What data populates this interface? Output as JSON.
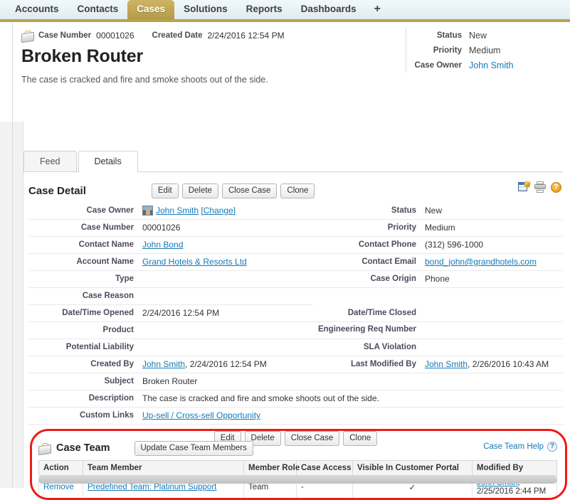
{
  "nav": {
    "tabs": [
      {
        "label": "Accounts",
        "active": false
      },
      {
        "label": "Contacts",
        "active": false
      },
      {
        "label": "Cases",
        "active": true
      },
      {
        "label": "Solutions",
        "active": false
      },
      {
        "label": "Reports",
        "active": false
      },
      {
        "label": "Dashboards",
        "active": false
      }
    ],
    "add_tab_label": "+"
  },
  "record_header": {
    "case_number_label": "Case Number",
    "case_number_value": "00001026",
    "created_date_label": "Created Date",
    "created_date_value": "2/24/2016 12:54 PM",
    "title": "Broken Router",
    "description": "The case is cracked and fire and smoke shoots out of the side.",
    "highlights": [
      {
        "label": "Status",
        "value": "New",
        "link": false
      },
      {
        "label": "Priority",
        "value": "Medium",
        "link": false
      },
      {
        "label": "Case Owner",
        "value": "John Smith",
        "link": true
      }
    ]
  },
  "subtabs": [
    {
      "label": "Feed",
      "active": false
    },
    {
      "label": "Details",
      "active": true
    }
  ],
  "case_detail": {
    "title": "Case Detail",
    "buttons": [
      "Edit",
      "Delete",
      "Close Case",
      "Clone"
    ],
    "buttons_bottom": [
      "Edit",
      "Delete",
      "Close Case",
      "Clone"
    ],
    "icons": [
      "edit-layout-icon",
      "printer-icon",
      "help-icon"
    ],
    "rows": [
      {
        "label": "Case Owner",
        "value": "John Smith",
        "link": true,
        "avatar": true,
        "change": "[Change]",
        "label2": "Status",
        "value2": "New",
        "link2": false
      },
      {
        "label": "Case Number",
        "value": "00001026",
        "link": false,
        "label2": "Priority",
        "value2": "Medium",
        "link2": false
      },
      {
        "label": "Contact Name",
        "value": "John Bond",
        "link": true,
        "label2": "Contact Phone",
        "value2": "(312) 596-1000",
        "link2": false
      },
      {
        "label": "Account Name",
        "value": "Grand Hotels & Resorts Ltd",
        "link": true,
        "label2": "Contact Email",
        "value2": "bond_john@grandhotels.com",
        "link2": true
      },
      {
        "label": "Type",
        "value": "",
        "link": false,
        "label2": "Case Origin",
        "value2": "Phone",
        "link2": false
      },
      {
        "label": "Case Reason",
        "value": "",
        "link": false,
        "label2": "",
        "value2": "",
        "link2": false
      },
      {
        "label": "Date/Time Opened",
        "value": "2/24/2016 12:54 PM",
        "link": false,
        "label2": "Date/Time Closed",
        "value2": "",
        "link2": false
      },
      {
        "label": "Product",
        "value": "",
        "link": false,
        "label2": "Engineering Req Number",
        "value2": "",
        "link2": false
      },
      {
        "label": "Potential Liability",
        "value": "",
        "link": false,
        "label2": "SLA Violation",
        "value2": "",
        "link2": false
      },
      {
        "label": "Created By",
        "value": "John Smith",
        "link": true,
        "suffix": ", 2/24/2016 12:54 PM",
        "label2": "Last Modified By",
        "value2": "John Smith",
        "link2": true,
        "suffix2": ", 2/26/2016 10:43 AM"
      }
    ],
    "wide_rows": [
      {
        "label": "Subject",
        "value": "Broken Router",
        "link": false
      },
      {
        "label": "Description",
        "value": "The case is cracked and fire and smoke shoots out of the side.",
        "link": false
      },
      {
        "label": "Custom Links",
        "value": "Up-sell / Cross-sell Opportunity",
        "link": true
      }
    ]
  },
  "case_team": {
    "title": "Case Team",
    "update_button": "Update Case Team Members",
    "help_link": "Case Team Help",
    "help_icon_label": "?",
    "columns": [
      "Action",
      "Team Member",
      "Member Role",
      "Case Access",
      "Visible In Customer Portal",
      "Modified By"
    ],
    "rows": [
      {
        "action": "Remove",
        "team_member": "Predefined Team: Platinum Support",
        "member_role": "Team",
        "case_access": "-",
        "visible_in_portal": "✓",
        "modified_by": "John Smith",
        "modified_when": ", 2/25/2016 2:44 PM"
      }
    ]
  },
  "colors": {
    "accent_gold": "#b9a24a",
    "link_blue": "#1579b8",
    "highlight_red": "#ee1b16"
  }
}
